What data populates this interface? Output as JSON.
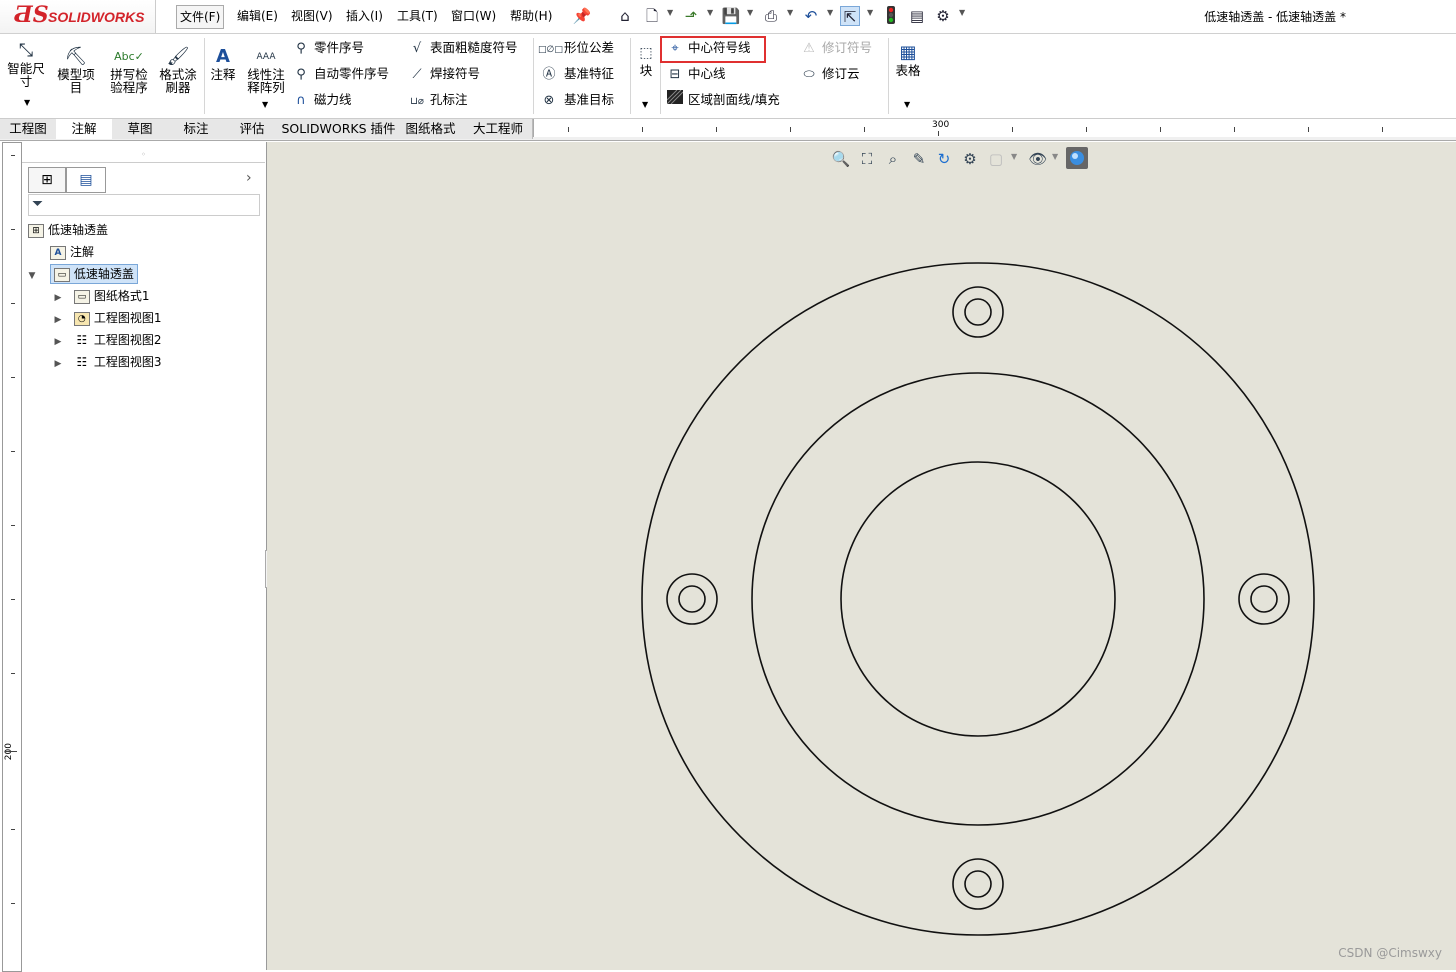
{
  "app": {
    "logo_mark": "ƋS",
    "logo_text": "SOLIDWORKS",
    "document_title": "低速轴透盖 - 低速轴透盖 *"
  },
  "menu": [
    "文件(F)",
    "编辑(E)",
    "视图(V)",
    "插入(I)",
    "工具(T)",
    "窗口(W)",
    "帮助(H)"
  ],
  "quick_access": [
    "home-icon",
    "new-document-icon",
    "open-icon",
    "save-icon",
    "print-icon",
    "undo-icon",
    "select-icon",
    "traffic-light-icon",
    "file-properties-icon",
    "options-gear-icon"
  ],
  "ribbon": {
    "smart_dimension": "智能尺寸",
    "model_items": "模型项目",
    "spell_checker": "拼写检验程序",
    "format_painter": "格式涂刷器",
    "note": "注释",
    "linear_note_pattern": "线性注释阵列",
    "balloon": "零件序号",
    "auto_balloon": "自动零件序号",
    "magnetic_line": "磁力线",
    "surface_finish": "表面粗糙度符号",
    "weld_symbol": "焊接符号",
    "hole_callout": "孔标注",
    "geometric_tolerance": "形位公差",
    "datum_feature": "基准特征",
    "datum_target": "基准目标",
    "block": "块",
    "center_mark": "中心符号线",
    "centerline": "中心线",
    "area_hatch": "区域剖面线/填充",
    "revision_symbol": "修订符号",
    "revision_cloud": "修订云",
    "table": "表格",
    "hole_callout_glyph": "⊔⌀",
    "gtol_glyph": "□∅□"
  },
  "tabs": [
    {
      "label": "工程图",
      "active": false
    },
    {
      "label": "注解",
      "active": true
    },
    {
      "label": "草图",
      "active": false
    },
    {
      "label": "标注",
      "active": false
    },
    {
      "label": "评估",
      "active": false
    },
    {
      "label": "SOLIDWORKS 插件",
      "active": false
    },
    {
      "label": "图纸格式",
      "active": false
    },
    {
      "label": "大工程师",
      "active": false
    }
  ],
  "ruler": {
    "top_label": "300",
    "left_label": "200"
  },
  "tree": {
    "root": "低速轴透盖",
    "annotations": "注解",
    "sheet": "低速轴透盖",
    "items": [
      "图纸格式1",
      "工程图视图1",
      "工程图视图2",
      "工程图视图3"
    ]
  },
  "heads_up_toolbar": [
    "zoom-to-fit-icon",
    "zoom-to-area-icon",
    "previous-view-icon",
    "section-view-icon",
    "rotate-icon",
    "view-orientation-icon",
    "display-style-icon",
    "hide-show-icon",
    "scene-icon"
  ],
  "watermark": "CSDN @Cimswxy",
  "colors": {
    "highlight": "#e03030",
    "canvas_bg": "#e4e3d9",
    "brand_red": "#d3232a"
  }
}
